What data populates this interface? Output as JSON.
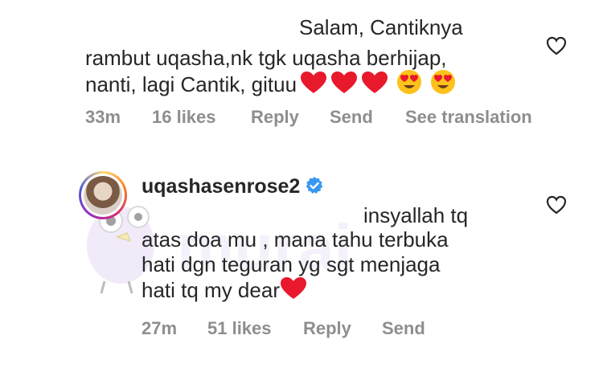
{
  "comment1": {
    "lines": [
      "Salam, Cantiknya",
      "rambut uqasha,nk tgk uqasha berhijap,",
      "nanti, lagi Cantik, gituu"
    ],
    "meta": {
      "time": "33m",
      "likes": "16 likes",
      "reply": "Reply",
      "send": "Send",
      "translation": "See translation"
    }
  },
  "comment2": {
    "username": "uqashasenrose2",
    "lines": [
      "insyallah tq",
      "atas doa mu , mana tahu terbuka",
      "hati dgn teguran yg sgt menjaga",
      "hati tq my dear"
    ],
    "meta": {
      "time": "27m",
      "likes": "51 likes",
      "reply": "Reply",
      "send": "Send"
    }
  },
  "colors": {
    "text": "#262626",
    "meta": "#8e8e8e",
    "heart_emoji": "#e8192c",
    "verified": "#3897f0",
    "watermark": "#d7c9ef"
  },
  "icons": [
    "heart-outline-icon",
    "red-heart-emoji",
    "heart-eyes-emoji",
    "verified-badge-icon"
  ],
  "watermark": "murai"
}
